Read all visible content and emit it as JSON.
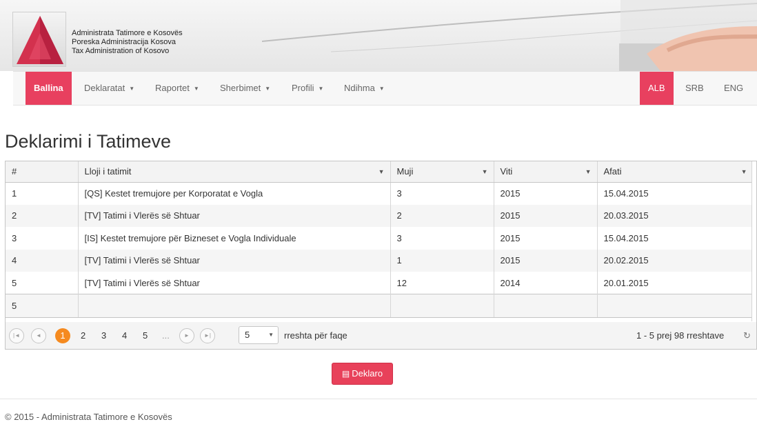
{
  "banner": {
    "org_lines": [
      "Administrata Tatimore e Kosovës",
      "Poreska Administracija Kosova",
      "Tax Administration of Kosovo"
    ]
  },
  "nav": {
    "items": [
      {
        "label": "Ballina",
        "active": true
      },
      {
        "label": "Deklaratat",
        "caret": true
      },
      {
        "label": "Raportet",
        "caret": true
      },
      {
        "label": "Sherbimet",
        "caret": true
      },
      {
        "label": "Profili",
        "caret": true
      },
      {
        "label": "Ndihma",
        "caret": true
      }
    ],
    "languages": [
      {
        "label": "ALB",
        "active": true
      },
      {
        "label": "SRB"
      },
      {
        "label": "ENG"
      }
    ]
  },
  "page_title": "Deklarimi i Tatimeve",
  "grid": {
    "columns": [
      "#",
      "Lloji i tatimit",
      "Muji",
      "Viti",
      "Afati"
    ],
    "rows": [
      [
        "1",
        "[QS] Kestet tremujore per Korporatat e Vogla",
        "3",
        "2015",
        "15.04.2015"
      ],
      [
        "2",
        "[TV] Tatimi i Vlerës së Shtuar",
        "2",
        "2015",
        "20.03.2015"
      ],
      [
        "3",
        "[IS] Kestet tremujore për Bizneset e Vogla Individuale",
        "3",
        "2015",
        "15.04.2015"
      ],
      [
        "4",
        "[TV] Tatimi i Vlerës së Shtuar",
        "1",
        "2015",
        "20.02.2015"
      ],
      [
        "5",
        "[TV] Tatimi i Vlerës së Shtuar",
        "12",
        "2014",
        "20.01.2015"
      ]
    ],
    "footer_count": "5"
  },
  "pager": {
    "current": "1",
    "pages": [
      "2",
      "3",
      "4",
      "5",
      "..."
    ],
    "page_size": "5",
    "page_size_label": "rreshta për faqe",
    "info": "1 - 5 prej 98 rreshtave"
  },
  "deklaro_label": "Deklaro",
  "footer_text": "© 2015 - Administrata Tatimore e Kosovës",
  "colors": {
    "accent": "#e8405f",
    "pager_current": "#f58a1f"
  }
}
